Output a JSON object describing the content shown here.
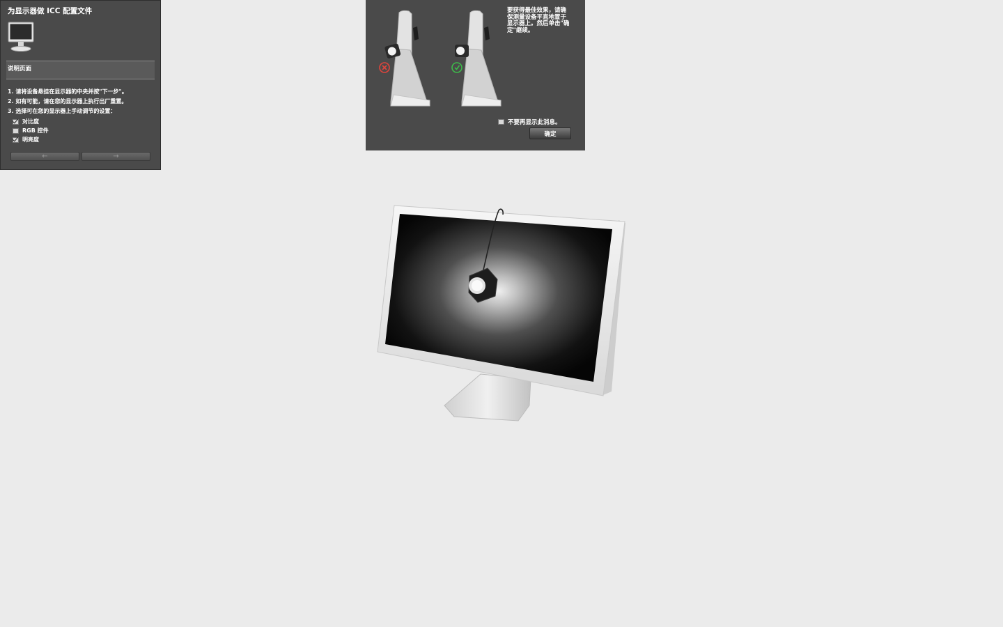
{
  "wizard": {
    "title": "为显示器做 ICC 配置文件",
    "section_title": "说明页面",
    "steps": [
      "1. 请将设备悬挂在显示器的中央并按\"下一步\"。",
      "2. 如有可能，请在您的显示器上执行出厂重置。",
      "3. 选择可在您的显示器上手动调节的设置："
    ],
    "options": [
      {
        "label": "对比度",
        "checked": true
      },
      {
        "label": "RGB 控件",
        "checked": false
      },
      {
        "label": "明亮度",
        "checked": true
      }
    ],
    "back_icon": "arrow-left-icon",
    "next_icon": "arrow-right-icon"
  },
  "dialog": {
    "message": "要获得最佳效果，请确保测量设备平直地置于显示器上。然后单击\"确定\"继续。",
    "dont_show_label": "不要再显示此消息。",
    "dont_show_checked": false,
    "ok_label": "确定",
    "wrong_icon": "x-circle-icon",
    "right_icon": "check-circle-icon",
    "wrong_color": "#e0443c",
    "right_color": "#3dbb4a"
  }
}
